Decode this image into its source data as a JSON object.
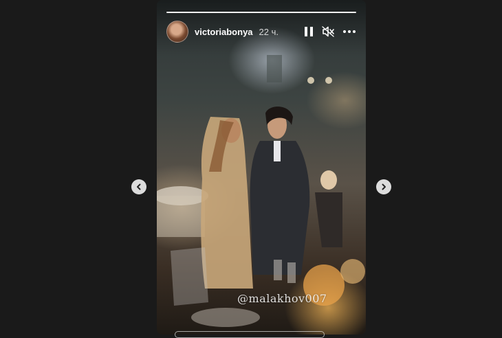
{
  "story": {
    "username": "victoriabonya",
    "time_ago": "22 ч.",
    "segments_total": 1,
    "mention": "@malakhov007"
  },
  "icons": {
    "pause": "pause-icon",
    "mute": "speaker-muted-icon",
    "more": "more-options-icon",
    "prev": "chevron-left-icon",
    "next": "chevron-right-icon"
  },
  "colors": {
    "background": "#1a1a1a",
    "text": "#ffffff"
  }
}
